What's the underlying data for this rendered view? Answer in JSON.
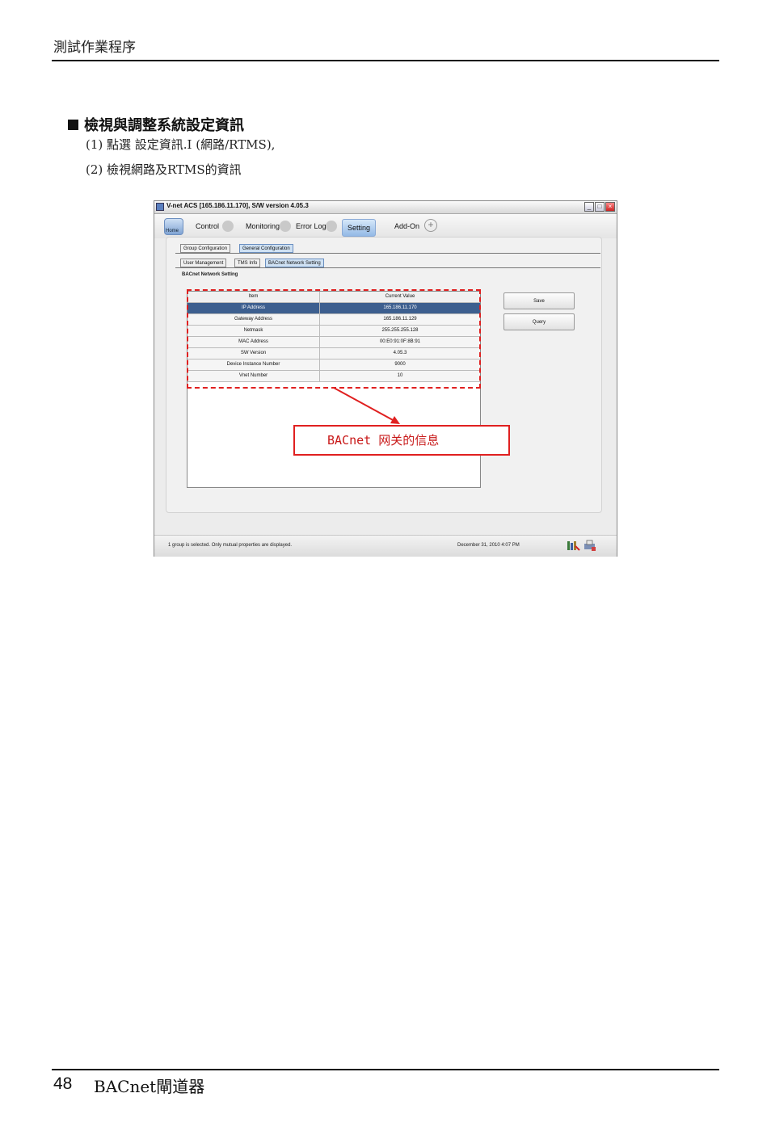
{
  "header": {
    "title": "測試作業程序"
  },
  "section": {
    "title": "檢視與調整系統設定資訊",
    "steps": [
      "(1) 點選 設定資訊.I (網路/RTMS),",
      "(2) 檢視網路及RTMS的資訊"
    ]
  },
  "app": {
    "title": "V-net ACS  [165.186.11.170],   S/W version  4.05.3",
    "window_controls": {
      "minimize": "_",
      "maximize": "□",
      "close": "×"
    },
    "menu": {
      "home": "Home",
      "tabs": [
        "Control",
        "Monitoring",
        "Error Log",
        "Setting",
        "Add-On"
      ],
      "add_symbol": "+"
    },
    "config_tabs": [
      "Group Configuration",
      "General Configuration"
    ],
    "sub_tabs": [
      "User Management",
      "TMS Info",
      "BACnet Network Setting"
    ],
    "group_label": "BACnet Network Setting",
    "table": {
      "columns": [
        "Item",
        "Current Value"
      ],
      "rows": [
        [
          "IP Address",
          "165.186.11.170"
        ],
        [
          "Gateway Address",
          "165.186.11.129"
        ],
        [
          "Netmask",
          "255.255.255.128"
        ],
        [
          "MAC Address",
          "00:E0:91:0F:8B:91"
        ],
        [
          "SW Version",
          "4.05.3"
        ],
        [
          "Device Instance Number",
          "9000"
        ],
        [
          "Vnet Number",
          "10"
        ]
      ],
      "selected_row": 0
    },
    "buttons": {
      "save": "Save",
      "query": "Query"
    },
    "callout": "BACnet 网关的信息",
    "status": {
      "message": "1 group is selected. Only mutual properties are displayed.",
      "datetime": "December 31, 2010  4:07 PM"
    },
    "colors": {
      "highlight": "#e02020",
      "selection": "#3d5f8f"
    }
  },
  "footer": {
    "page_number": "48",
    "title": "BACnet閘道器"
  }
}
